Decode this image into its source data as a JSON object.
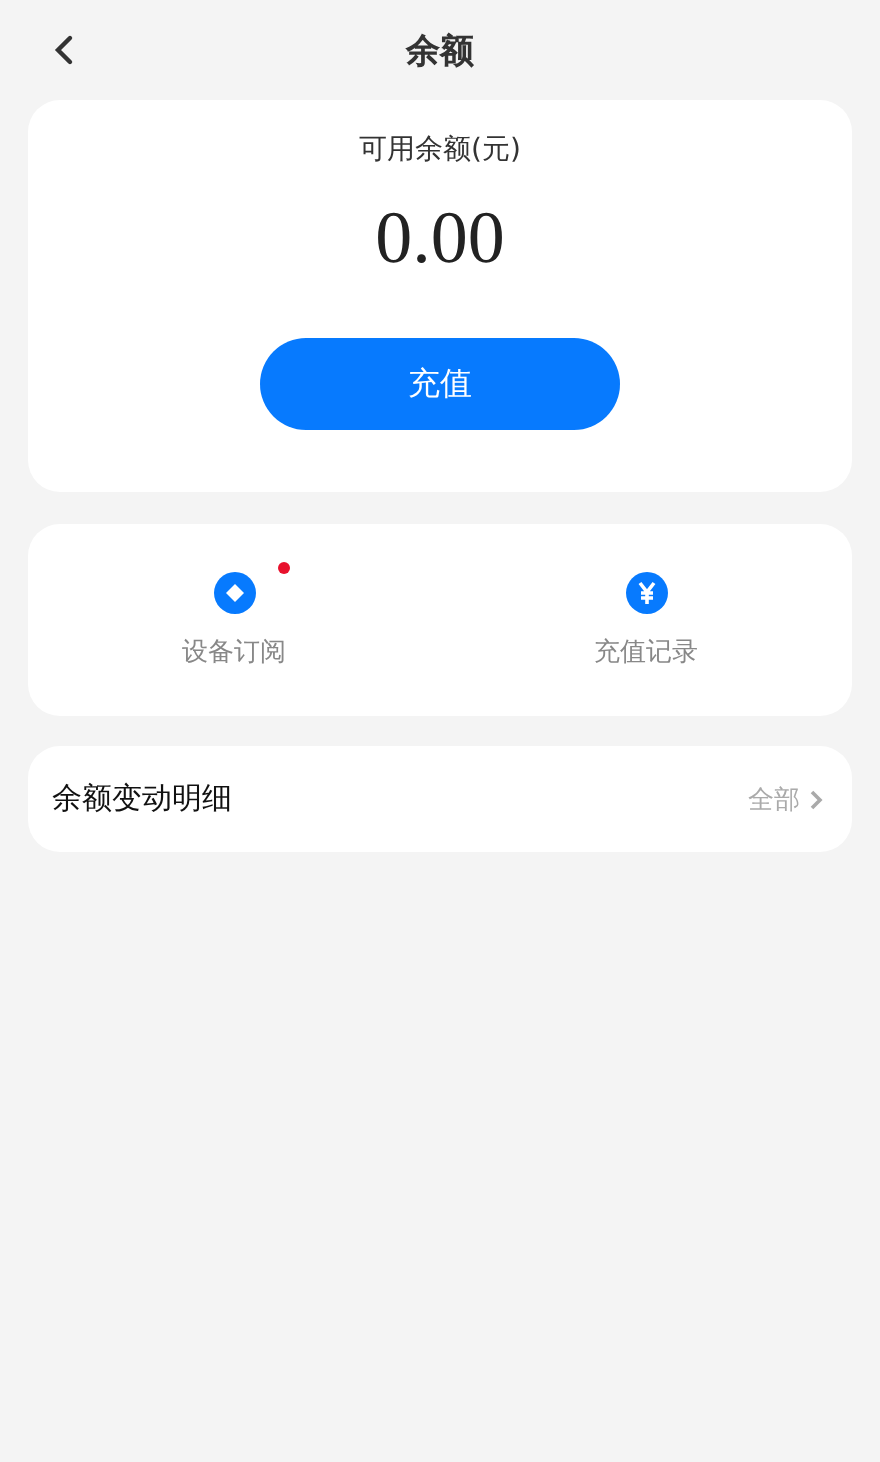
{
  "header": {
    "title": "余额"
  },
  "balance": {
    "label": "可用余额(元)",
    "amount": "0.00",
    "button": "充值"
  },
  "shortcuts": [
    {
      "kind": "subscription",
      "label": "设备订阅",
      "badge": true
    },
    {
      "kind": "records",
      "label": "充值记录",
      "badge": false
    }
  ],
  "details": {
    "title": "余额变动明细",
    "link": "全部"
  }
}
